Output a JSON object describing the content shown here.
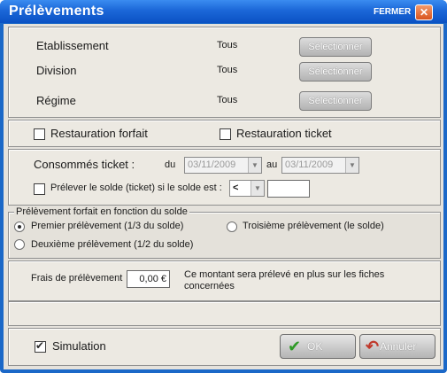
{
  "window": {
    "title": "Prélèvements",
    "close_label": "FERMER",
    "close_glyph": "✕"
  },
  "filters": [
    {
      "label": "Etablissement",
      "value": "Tous",
      "button": "Sélectionner"
    },
    {
      "label": "Division",
      "value": "Tous",
      "button": "Sélectionner"
    },
    {
      "label": "Régime",
      "value": "Tous",
      "button": "Sélectionner"
    }
  ],
  "restauration": {
    "forfait_label": "Restauration forfait",
    "forfait_checked": false,
    "ticket_label": "Restauration ticket",
    "ticket_checked": false
  },
  "consommes": {
    "label": "Consommés ticket :",
    "du_label": "du",
    "du_value": "03/11/2009",
    "au_label": "au",
    "au_value": "03/11/2009",
    "prelever_label": "Prélever le solde (ticket) si le solde est :",
    "prelever_checked": false,
    "operator_value": "<",
    "amount_value": ""
  },
  "forfait_group": {
    "legend": "Prélèvement forfait en fonction du solde",
    "options": [
      {
        "label": "Premier prélèvement (1/3 du solde)",
        "selected": true
      },
      {
        "label": "Troisième prélèvement (le solde)",
        "selected": false
      },
      {
        "label": "Deuxième prélèvement (1/2 du solde)",
        "selected": false
      }
    ]
  },
  "frais": {
    "label": "Frais de prélèvement",
    "value": "0,00 €",
    "note": "Ce montant sera prélevé en plus sur les fiches concernées"
  },
  "footer": {
    "simulation_label": "Simulation",
    "simulation_checked": true,
    "ok_label": "OK",
    "ok_icon": "check-icon",
    "annuler_label": "Annuler",
    "annuler_icon": "undo-arrow-icon"
  },
  "colors": {
    "titlebar": "#1b67d8",
    "panel": "#ece9e2",
    "ok_check": "#2e9a26",
    "annuler_arrow": "#c0392b"
  }
}
